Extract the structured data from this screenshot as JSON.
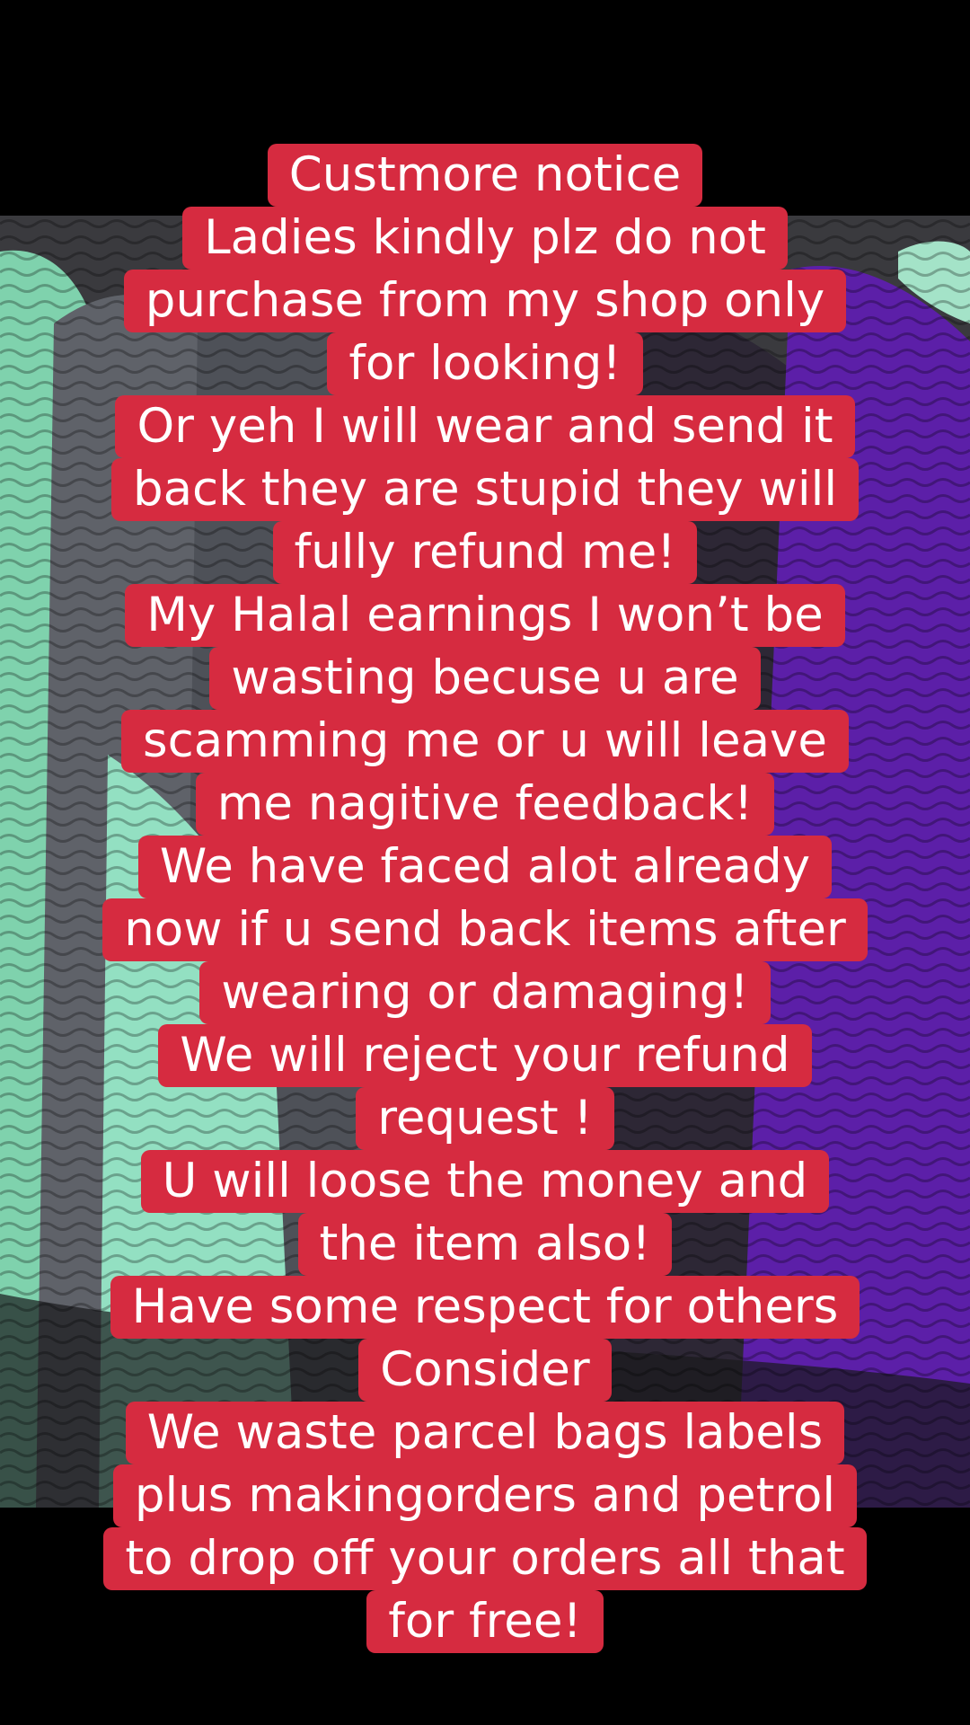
{
  "background_color": "#000000",
  "caption_box_color": "#d62b40",
  "caption_text_color": "#ffffff",
  "photo_description_colors": {
    "mint": "#8ad9b6",
    "slate_grey": "#5d6066",
    "purple": "#5a1fa8",
    "black_fabric": "#2a2530"
  },
  "caption": {
    "lines": [
      "Custmore notice",
      "Ladies kindly plz do not",
      "purchase from my shop only",
      "for looking!",
      "Or yeh I will wear and send it",
      "back they are stupid they will",
      "fully refund me!",
      "My Halal earnings I won’t be",
      "wasting becuse u are",
      "scamming me or u will leave",
      "me nagitive feedback!",
      "We have faced alot already",
      "now if u send back items after",
      "wearing or damaging!",
      "We will reject your refund",
      "request !",
      "U will loose the money and",
      "the item also!",
      "Have some respect for others",
      "Consider",
      "We waste parcel bags labels",
      "plus makingorders and petrol",
      "to drop off your orders all that",
      "for free!"
    ]
  }
}
